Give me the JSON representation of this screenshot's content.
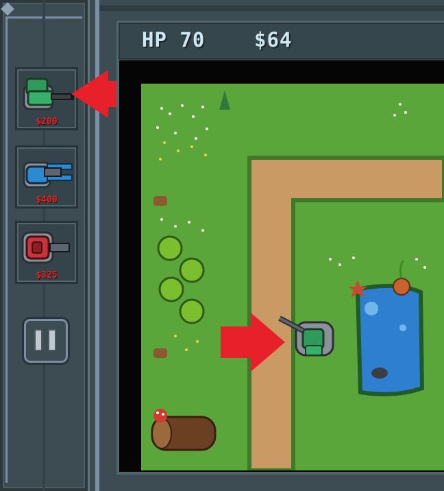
{
  "hud": {
    "hp": "HP 70",
    "money": "$64"
  },
  "shop": [
    {
      "name": "green-gatling-turret",
      "price": "$200",
      "color": "#2e9b5a"
    },
    {
      "name": "blue-laser-turret",
      "price": "$400",
      "color": "#2d8ad1"
    },
    {
      "name": "red-cannon-turret",
      "price": "$325",
      "color": "#c6343c"
    }
  ],
  "colors": {
    "grass": "#5aa63a",
    "path": "#c99a63",
    "water": "#2e7fd0",
    "arrow": "#e8202a",
    "price_text": "#e02424"
  }
}
